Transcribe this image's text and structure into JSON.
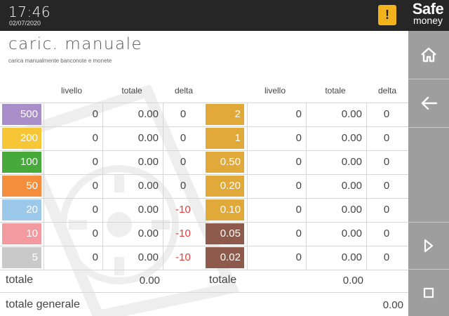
{
  "status_bar": {
    "time": "17:46",
    "date": "02/07/2020",
    "alert_symbol": "!",
    "brand_line1": "Safe",
    "brand_line2": "money"
  },
  "header": {
    "title": "caric. manuale",
    "subtitle": "carica manualmente banconote e monete"
  },
  "columns": {
    "level": "livello",
    "total": "totale",
    "delta": "delta"
  },
  "banknotes": [
    {
      "denomination": "500",
      "color": "#a98fc9",
      "level": "0",
      "total": "0.00",
      "delta": "0"
    },
    {
      "denomination": "200",
      "color": "#f7c636",
      "level": "0",
      "total": "0.00",
      "delta": "0"
    },
    {
      "denomination": "100",
      "color": "#47a93a",
      "level": "0",
      "total": "0.00",
      "delta": "0"
    },
    {
      "denomination": "50",
      "color": "#f48d3c",
      "level": "0",
      "total": "0.00",
      "delta": "0"
    },
    {
      "denomination": "20",
      "color": "#9cc8ea",
      "level": "0",
      "total": "0.00",
      "delta": "-10"
    },
    {
      "denomination": "10",
      "color": "#f29aa0",
      "level": "0",
      "total": "0.00",
      "delta": "-10"
    },
    {
      "denomination": "5",
      "color": "#c9c9c9",
      "level": "0",
      "total": "0.00",
      "delta": "-10"
    }
  ],
  "coins": [
    {
      "denomination": "2",
      "color": "#e0a93a",
      "level": "0",
      "total": "0.00",
      "delta": "0"
    },
    {
      "denomination": "1",
      "color": "#e0a93a",
      "level": "0",
      "total": "0.00",
      "delta": "0"
    },
    {
      "denomination": "0.50",
      "color": "#e0a93a",
      "level": "0",
      "total": "0.00",
      "delta": "0"
    },
    {
      "denomination": "0.20",
      "color": "#e0a93a",
      "level": "0",
      "total": "0.00",
      "delta": "0"
    },
    {
      "denomination": "0.10",
      "color": "#e0a93a",
      "level": "0",
      "total": "0.00",
      "delta": "0"
    },
    {
      "denomination": "0.05",
      "color": "#8e5a4c",
      "level": "0",
      "total": "0.00",
      "delta": "0"
    },
    {
      "denomination": "0.02",
      "color": "#8e5a4c",
      "level": "0",
      "total": "0.00",
      "delta": "0"
    }
  ],
  "totals": {
    "banknotes_label": "totale",
    "banknotes_value": "0.00",
    "coins_label": "totale",
    "coins_value": "0.00",
    "grand_label": "totale generale",
    "grand_value": "0.00"
  },
  "side_panel": {
    "buttons": [
      "home-icon",
      "back-arrow-icon",
      "empty",
      "play-icon",
      "stop-icon"
    ]
  },
  "colors": {
    "top_bar": "#262626",
    "side_panel": "#9e9e9e",
    "alert": "#f2b21b",
    "negative_delta": "#e23b3b"
  }
}
